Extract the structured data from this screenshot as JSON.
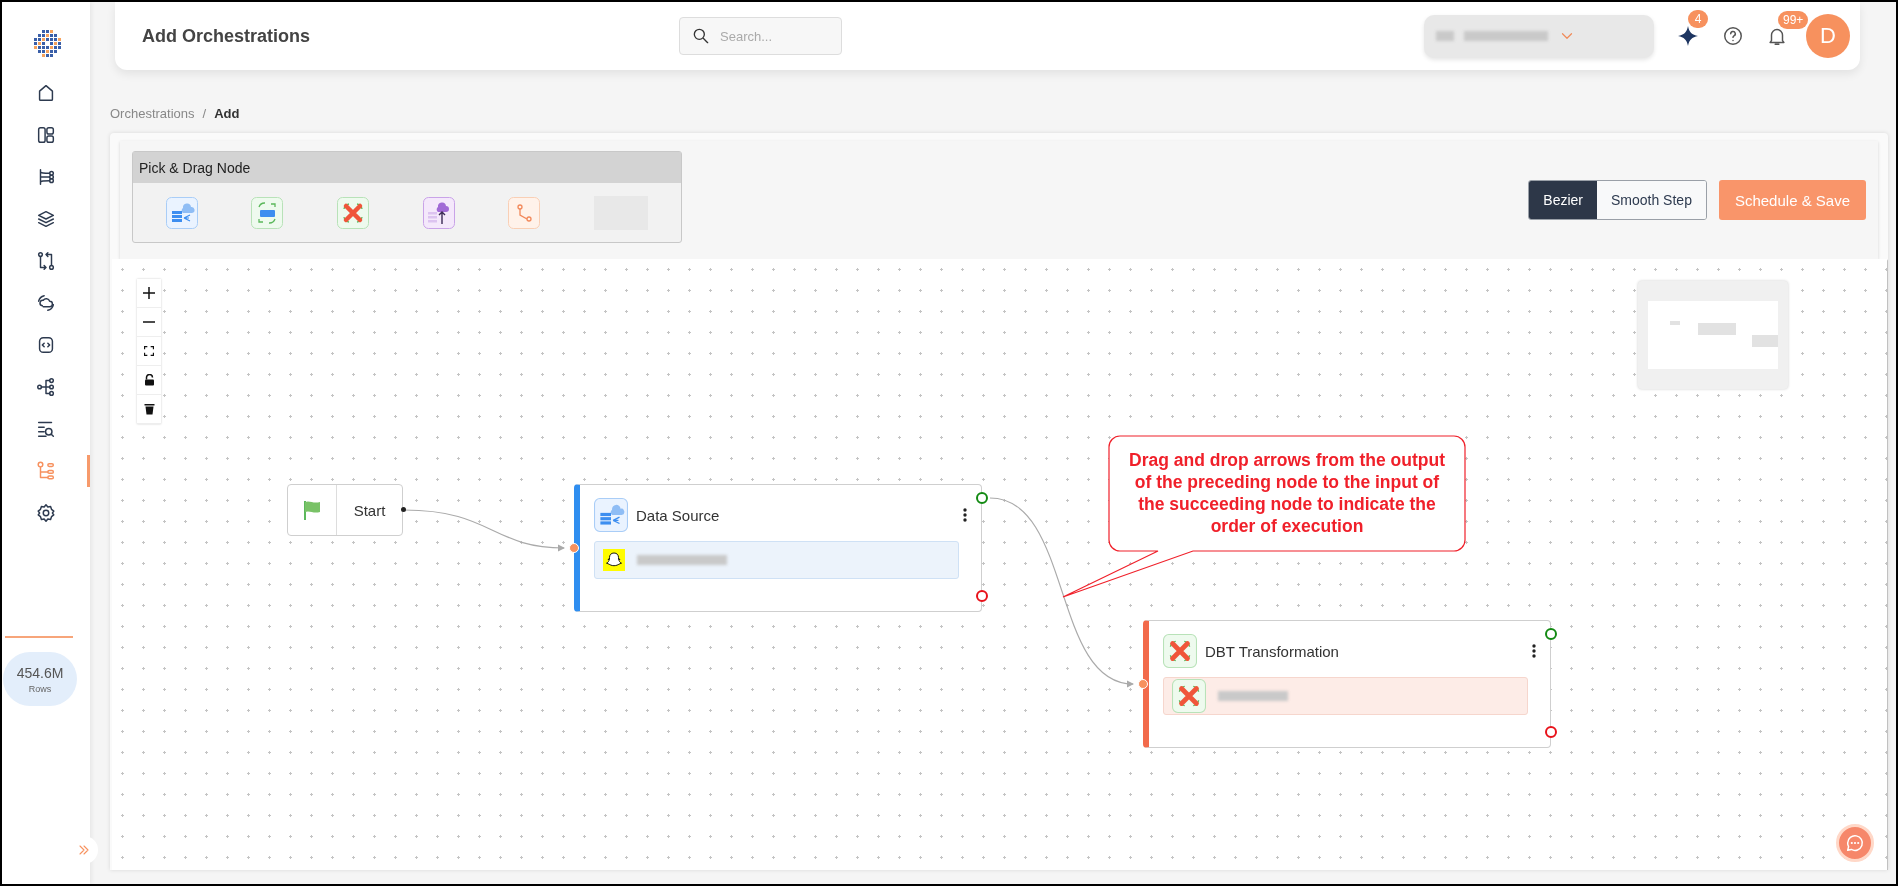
{
  "sidebar": {
    "items": [
      {
        "selected": false
      },
      {
        "selected": false
      },
      {
        "selected": false
      },
      {
        "selected": false
      },
      {
        "selected": false
      },
      {
        "selected": false
      },
      {
        "selected": false
      },
      {
        "selected": false
      },
      {
        "selected": false
      },
      {
        "selected": true
      },
      {
        "selected": false
      }
    ],
    "usage": {
      "value": "454.6M",
      "unit": "Rows"
    }
  },
  "header": {
    "title": "Add Orchestrations",
    "search": {
      "placeholder": "Search..."
    },
    "ai_badge": "4",
    "notifications_badge": "99+",
    "avatar": "D"
  },
  "breadcrumb": [
    "Orchestrations",
    "Add"
  ],
  "breadcrumb_separator": "/",
  "palette": {
    "title": "Pick & Drag Node",
    "nodes": [
      {
        "kind": "source"
      },
      {
        "kind": "sql"
      },
      {
        "kind": "dbt"
      },
      {
        "kind": "destination"
      },
      {
        "kind": "branch"
      },
      {
        "kind": "empty"
      }
    ]
  },
  "edge_styles": [
    {
      "label": "Bezier",
      "selected": true
    },
    {
      "label": "Smooth Step",
      "selected": false
    }
  ],
  "primary_action": "Schedule & Save",
  "canvas": {
    "nodes": [
      {
        "kind": "start",
        "label": "Start"
      },
      {
        "kind": "source",
        "label": "Data Source"
      },
      {
        "kind": "dbt",
        "label": "DBT Transformation"
      }
    ],
    "callout": "Drag and drop arrows from the output of the preceding node to the input of the succeeding node to indicate the order of execution"
  }
}
